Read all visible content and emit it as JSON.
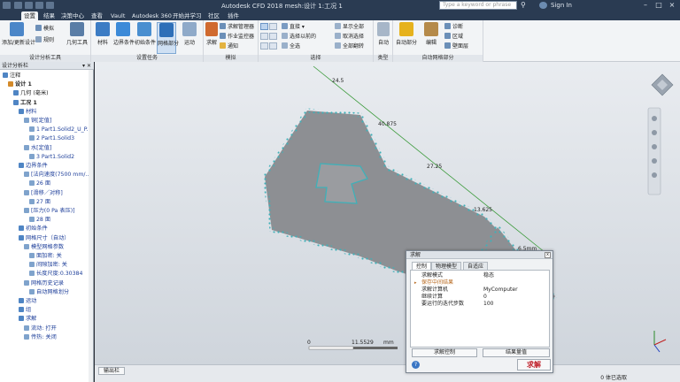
{
  "app": {
    "title": "Autodesk CFD 2018  mesh:设计 1:工况 1",
    "search_placeholder": "Type a keyword or phrase",
    "sign_in": "Sign In"
  },
  "tabs": [
    "设置",
    "结果",
    "决策中心",
    "查看",
    "Vault",
    "Autodesk 360",
    "开始并学习",
    "社区",
    "插件"
  ],
  "ribbon": {
    "groups": [
      {
        "label": "设计分析工具",
        "buttons": [
          "添加/更新设计",
          "几何工具"
        ],
        "small": [
          "模拟",
          "规则"
        ]
      },
      {
        "label": "设置任务",
        "buttons": [
          "材料",
          "边界条件",
          "初始条件",
          "网格部分",
          "运动"
        ]
      },
      {
        "label": "模拟",
        "buttons": [
          "求解"
        ],
        "small": [
          "求解管理器",
          "作业监控器",
          "通知"
        ]
      },
      {
        "label": "选择",
        "small": [
          "直接",
          "选择以前的",
          "全选",
          "显示全部",
          "取消选择",
          "全部翻转"
        ]
      },
      {
        "label": "类型",
        "buttons": [
          "自动"
        ]
      },
      {
        "label": "自动网格部分",
        "buttons": [
          "自动部分",
          "编辑"
        ],
        "small": [
          "诊断",
          "区域",
          "壁面层"
        ]
      }
    ]
  },
  "panel": {
    "title": "设计分析栏",
    "tree": [
      {
        "text": "注释",
        "indent": 0,
        "bold": false,
        "blue": false
      },
      {
        "text": "设计 1",
        "indent": 1,
        "bold": true,
        "blue": false
      },
      {
        "text": "几何 (毫米)",
        "indent": 2,
        "bold": false,
        "blue": false
      },
      {
        "text": "工况 1",
        "indent": 2,
        "bold": true,
        "blue": false
      },
      {
        "text": "材料",
        "indent": 3,
        "bold": false,
        "blue": true
      },
      {
        "text": "铜[定值]",
        "indent": 4,
        "bold": false,
        "blue": true
      },
      {
        "text": "1 Part1.Solid2_U_P...",
        "indent": 5,
        "bold": false,
        "blue": true
      },
      {
        "text": "2 Part1.Solid3",
        "indent": 5,
        "bold": false,
        "blue": true
      },
      {
        "text": "水[定值]",
        "indent": 4,
        "bold": false,
        "blue": true
      },
      {
        "text": "3 Part1.Solid2",
        "indent": 5,
        "bold": false,
        "blue": true
      },
      {
        "text": "边界条件",
        "indent": 3,
        "bold": false,
        "blue": true
      },
      {
        "text": "[法向速度(7500 mm/...",
        "indent": 4,
        "bold": false,
        "blue": true
      },
      {
        "text": "26 面",
        "indent": 5,
        "bold": false,
        "blue": true
      },
      {
        "text": "[滑移／对称]",
        "indent": 4,
        "bold": false,
        "blue": true
      },
      {
        "text": "27 面",
        "indent": 5,
        "bold": false,
        "blue": true
      },
      {
        "text": "[压力(0 Pa 表压)]",
        "indent": 4,
        "bold": false,
        "blue": true
      },
      {
        "text": "28 面",
        "indent": 5,
        "bold": false,
        "blue": true
      },
      {
        "text": "初始条件",
        "indent": 3,
        "bold": false,
        "blue": true
      },
      {
        "text": "网格尺寸（自动）",
        "indent": 3,
        "bold": false,
        "blue": true
      },
      {
        "text": "模型网格参数",
        "indent": 4,
        "bold": false,
        "blue": true
      },
      {
        "text": "面加密: 关",
        "indent": 5,
        "bold": false,
        "blue": true
      },
      {
        "text": "间隙加密: 关",
        "indent": 5,
        "bold": false,
        "blue": true
      },
      {
        "text": "长度尺度:0.30384",
        "indent": 5,
        "bold": false,
        "blue": true
      },
      {
        "text": "网格历史记录",
        "indent": 4,
        "bold": false,
        "blue": true
      },
      {
        "text": "自动网格划分",
        "indent": 5,
        "bold": false,
        "blue": true
      },
      {
        "text": "运动",
        "indent": 3,
        "bold": false,
        "blue": true
      },
      {
        "text": "组",
        "indent": 3,
        "bold": false,
        "blue": true
      },
      {
        "text": "求解",
        "indent": 3,
        "bold": false,
        "blue": true
      },
      {
        "text": "流动: 打开",
        "indent": 4,
        "bold": false,
        "blue": true
      },
      {
        "text": "传热: 关闭",
        "indent": 4,
        "bold": false,
        "blue": true
      }
    ]
  },
  "viewport": {
    "dims": [
      "24.5",
      "40.875",
      "27.25",
      "13.625",
      "6.5mm"
    ],
    "scale_values": [
      "0",
      "11.5529",
      "mm"
    ]
  },
  "status": {
    "output_button": "输出栏",
    "selection": "0 体已选取"
  },
  "dialog": {
    "title": "求解",
    "tabs": [
      "控制",
      "物理模型",
      "自适应"
    ],
    "rows": [
      {
        "key": "求解模式",
        "value": "稳态"
      },
      {
        "key": "保存中间结果",
        "value": ""
      },
      {
        "key": "求解计算机",
        "value": "MyComputer"
      },
      {
        "key": "继续计算",
        "value": "0"
      },
      {
        "key": "要运行的迭代步数",
        "value": "100"
      }
    ],
    "buttons": [
      "求解控制",
      "结果量值"
    ],
    "solve": "求解"
  }
}
